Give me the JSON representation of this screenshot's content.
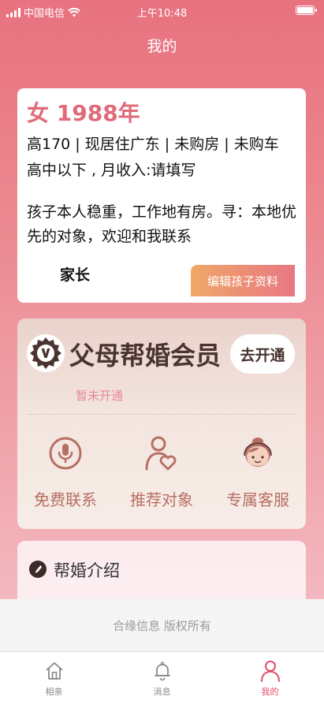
{
  "status_bar": {
    "carrier": "中国电信",
    "time": "上午10:48"
  },
  "page": {
    "title": "我的"
  },
  "profile": {
    "headline": "女 1988年",
    "line1": "高170 | 现居住广东 | 未购房 | 未购车",
    "line2": "高中以下 , 月收入:请填写",
    "description": "孩子本人稳重，工作地有房。寻：本地优先的对象，欢迎和我联系",
    "parent_label": "家长",
    "edit_label": "编辑孩子资料"
  },
  "membership": {
    "title": "父母帮婚会员",
    "open_label": "去开通",
    "status": "暂未开通",
    "benefits": [
      {
        "label": "免费联系",
        "icon": "microphone-icon"
      },
      {
        "label": "推荐对象",
        "icon": "person-heart-icon"
      },
      {
        "label": "专属客服",
        "icon": "customer-service-icon"
      }
    ]
  },
  "intro": {
    "title": "帮婚介绍"
  },
  "footer": {
    "copyright": "合缘信息 版权所有"
  },
  "tabbar": {
    "items": [
      {
        "label": "相亲",
        "icon": "home-icon"
      },
      {
        "label": "消息",
        "icon": "bell-icon"
      },
      {
        "label": "我的",
        "icon": "person-icon",
        "active": true
      }
    ]
  },
  "colors": {
    "accent": "#e06b7a",
    "tab_active": "#e44d6a",
    "benefit_brown": "#b56f63"
  }
}
